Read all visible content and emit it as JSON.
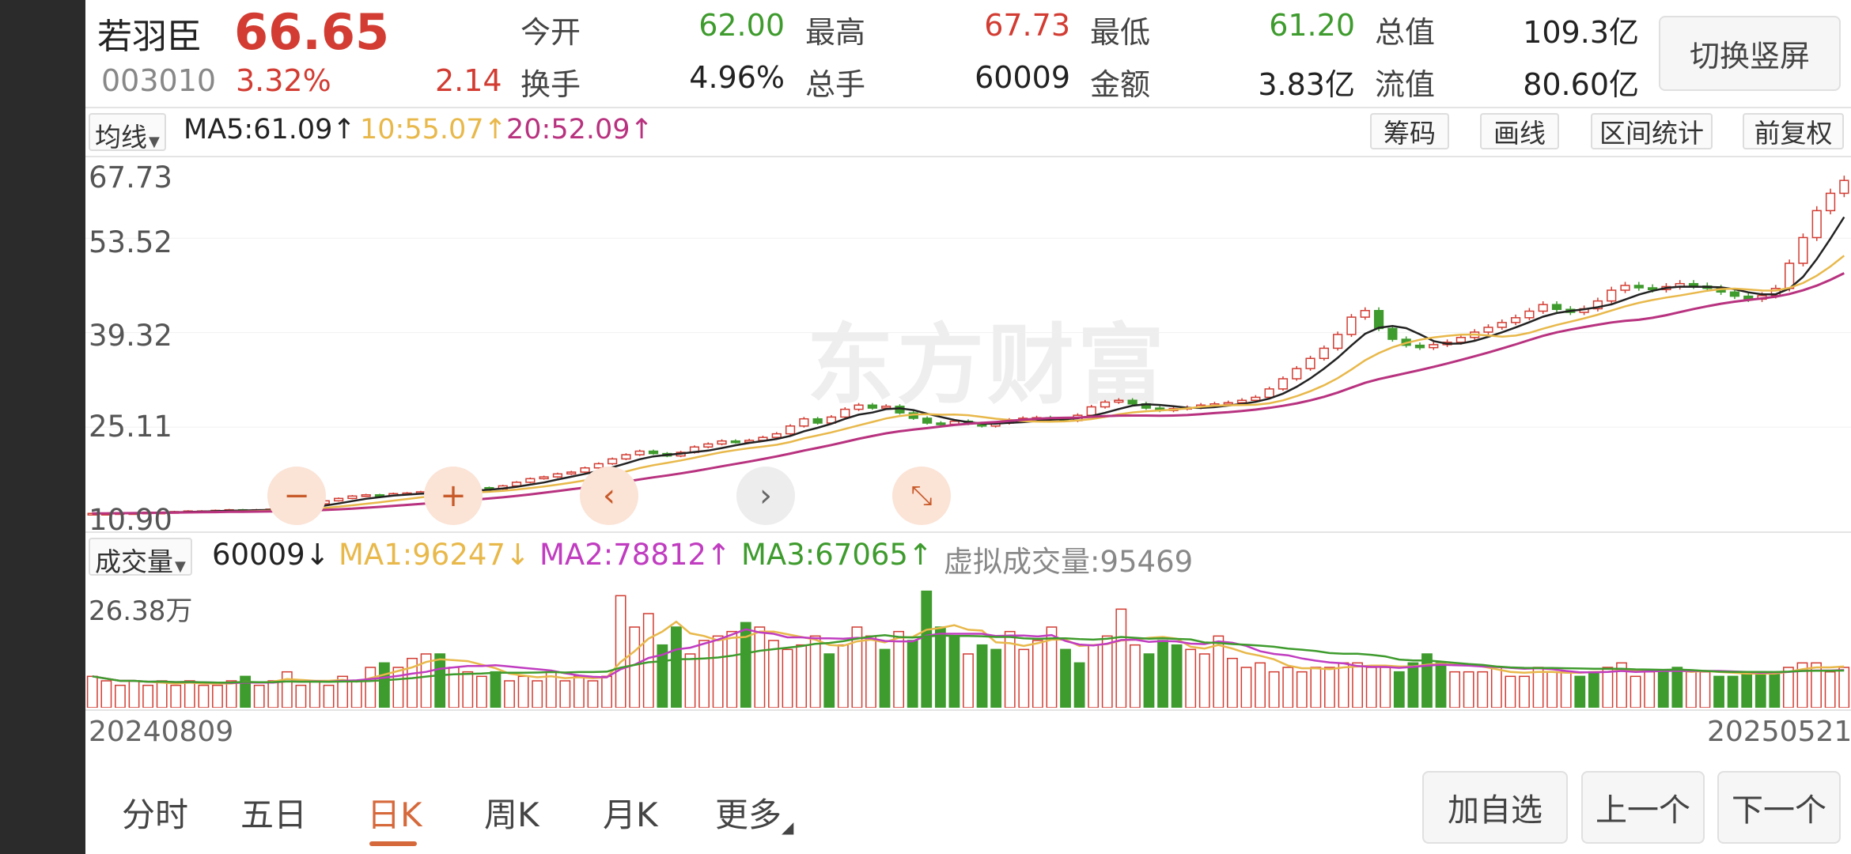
{
  "stock": {
    "name": "若羽臣",
    "code": "003010",
    "price": "66.65",
    "change_pct": "3.32%",
    "change": "2.14"
  },
  "quote": {
    "open_label": "今开",
    "open": "62.00",
    "high_label": "最高",
    "high": "67.73",
    "low_label": "最低",
    "low": "61.20",
    "total_cap_label": "总值",
    "total_cap": "109.3亿",
    "turnover_label": "换手",
    "turnover": "4.96%",
    "volume_label": "总手",
    "volume": "60009",
    "amount_label": "金额",
    "amount": "3.83亿",
    "float_cap_label": "流值",
    "float_cap": "80.60亿"
  },
  "switch_button": "切换竖屏",
  "ma_bar": {
    "selector": "均线",
    "ma5": "MA5:61.09↑",
    "ma10": "10:55.07↑",
    "ma20": "20:52.09↑",
    "buttons": [
      "筹码",
      "画线",
      "区间统计",
      "前复权"
    ]
  },
  "colors": {
    "up": "#d23c32",
    "down": "#3e9b2d",
    "ma5": "#222222",
    "ma10": "#e8b84a",
    "ma20": "#b8327f",
    "accent": "#d6693b"
  },
  "watermark": "东方财富",
  "controls": [
    "minus-icon",
    "plus-icon",
    "chevron-left-icon",
    "chevron-right-icon",
    "collapse-icon"
  ],
  "volume_bar": {
    "selector": "成交量",
    "current": "60009↓",
    "ma1": "MA1:96247↓",
    "ma2": "MA2:78812↑",
    "ma3": "MA3:67065↑",
    "virtual": "虚拟成交量:95469",
    "max_label": "26.38万"
  },
  "dates": {
    "start": "20240809",
    "end": "20250521"
  },
  "tabs": [
    "分时",
    "五日",
    "日K",
    "周K",
    "月K",
    "更多"
  ],
  "active_tab": "日K",
  "bottom_buttons": [
    "加自选",
    "上一个",
    "下一个"
  ],
  "chart_data": [
    {
      "type": "candlestick",
      "yticks": [
        "67.73",
        "53.52",
        "39.32",
        "25.11",
        "10.90"
      ],
      "ylim": [
        10.9,
        67.73
      ],
      "x_start": "20240809",
      "x_end": "20250521",
      "series": [
        {
          "name": "MA5",
          "last": 61.09
        },
        {
          "name": "MA10",
          "last": 55.07
        },
        {
          "name": "MA20",
          "last": 52.09
        }
      ],
      "close_approx": [
        11.0,
        11.0,
        11.1,
        11.1,
        11.2,
        11.2,
        11.3,
        11.4,
        11.4,
        11.5,
        11.6,
        11.5,
        11.6,
        11.7,
        11.9,
        12.2,
        12.6,
        13.1,
        13.5,
        13.9,
        14.1,
        14.0,
        14.3,
        14.4,
        14.6,
        14.5,
        14.8,
        15.0,
        15.3,
        15.1,
        15.6,
        16.2,
        16.8,
        17.1,
        17.6,
        17.9,
        18.6,
        19.3,
        20.1,
        20.8,
        21.4,
        21.0,
        20.6,
        21.2,
        22.1,
        22.6,
        23.1,
        22.9,
        23.2,
        23.7,
        24.3,
        25.6,
        26.8,
        26.1,
        27.1,
        28.4,
        29.1,
        28.6,
        28.9,
        27.8,
        26.9,
        26.1,
        25.9,
        26.4,
        26.0,
        25.6,
        26.1,
        26.6,
        26.9,
        27.0,
        26.7,
        26.5,
        27.4,
        28.8,
        29.6,
        29.9,
        29.3,
        28.6,
        28.2,
        28.5,
        28.7,
        29.1,
        29.3,
        29.5,
        29.9,
        30.4,
        31.8,
        33.5,
        35.2,
        36.9,
        38.6,
        40.9,
        43.8,
        44.9,
        41.9,
        40.1,
        39.1,
        38.7,
        39.2,
        39.6,
        40.4,
        41.3,
        42.1,
        42.9,
        43.7,
        44.8,
        45.9,
        45.1,
        44.6,
        45.2,
        46.5,
        48.3,
        49.1,
        48.7,
        48.4,
        48.9,
        49.4,
        49.0,
        48.6,
        48.0,
        47.3,
        46.8,
        47.4,
        48.6,
        52.8,
        57.1,
        61.6,
        64.5,
        66.65
      ]
    },
    {
      "type": "bar",
      "title": "成交量",
      "ymax_label": "26.38万",
      "series": [
        {
          "name": "MA1",
          "last": 96247
        },
        {
          "name": "MA2",
          "last": 78812
        },
        {
          "name": "MA3",
          "last": 67065
        }
      ],
      "values_approx": [
        7,
        6,
        5,
        6,
        5,
        6,
        5,
        6,
        5,
        5,
        6,
        7,
        5,
        6,
        8,
        5,
        6,
        5,
        7,
        6,
        9,
        10,
        9,
        11,
        12,
        12,
        9,
        8,
        7,
        8,
        6,
        7,
        6,
        8,
        6,
        7,
        6,
        7,
        25,
        18,
        21,
        14,
        18,
        12,
        15,
        16,
        17,
        19,
        18,
        15,
        13,
        14,
        16,
        12,
        14,
        18,
        16,
        13,
        17,
        15,
        26,
        18,
        16,
        12,
        14,
        13,
        17,
        13,
        15,
        18,
        13,
        10,
        14,
        16,
        22,
        14,
        12,
        15,
        14,
        13,
        12,
        16,
        11,
        9,
        10,
        8,
        9,
        8,
        9,
        9,
        10,
        10,
        9,
        9,
        8,
        10,
        12,
        10,
        8,
        8,
        8,
        9,
        7,
        7,
        9,
        8,
        8,
        7,
        8,
        9,
        10,
        7,
        8,
        8,
        9,
        8,
        8,
        7,
        7,
        8,
        8,
        8,
        9,
        10,
        10,
        8,
        9
      ]
    }
  ]
}
